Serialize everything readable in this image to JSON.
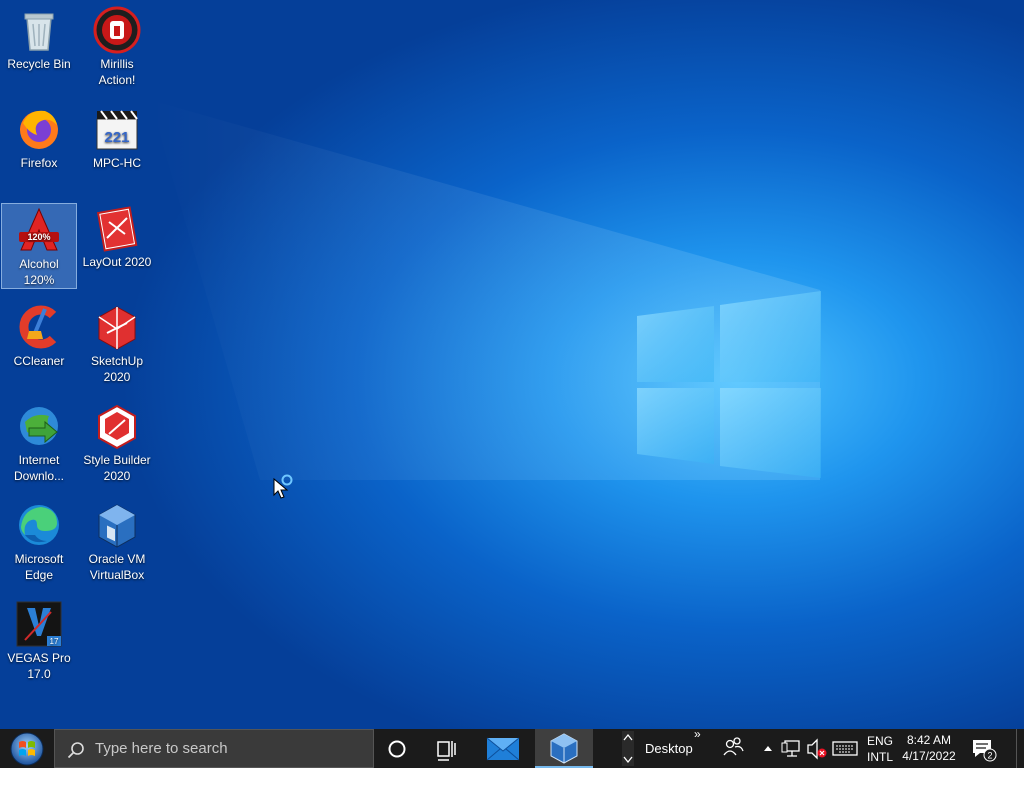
{
  "desktop": {
    "icons": [
      {
        "label": "Recycle Bin",
        "icon": "recycle-bin-icon"
      },
      {
        "label": "Mirillis Action!",
        "icon": "mirillis-action-icon"
      },
      {
        "label": "Firefox",
        "icon": "firefox-icon"
      },
      {
        "label": "MPC-HC",
        "icon": "mpc-hc-icon"
      },
      {
        "label": "Alcohol 120%",
        "icon": "alcohol-120-icon"
      },
      {
        "label": "LayOut 2020",
        "icon": "layout-2020-icon"
      },
      {
        "label": "CCleaner",
        "icon": "ccleaner-icon"
      },
      {
        "label": "SketchUp 2020",
        "icon": "sketchup-2020-icon"
      },
      {
        "label": "Internet Downlo...",
        "icon": "internet-download-manager-icon"
      },
      {
        "label": "Style Builder 2020",
        "icon": "style-builder-2020-icon"
      },
      {
        "label": "Microsoft Edge",
        "icon": "microsoft-edge-icon"
      },
      {
        "label": "Oracle VM VirtualBox",
        "icon": "virtualbox-icon"
      },
      {
        "label": "VEGAS Pro 17.0",
        "icon": "vegas-pro-icon"
      }
    ],
    "selected_icon": "Alcohol 120%"
  },
  "taskbar": {
    "search_placeholder": "Type here to search",
    "toolbar_label": "Desktop",
    "toolbar_more": "»",
    "language_line1": "ENG",
    "language_line2": "INTL",
    "time": "8:42 AM",
    "date": "4/17/2022",
    "notification_count": "2"
  },
  "colors": {
    "taskbar_bg": "#1b1b1b",
    "accent": "#76b9ed",
    "desktop_blue": "#0a63c9"
  }
}
